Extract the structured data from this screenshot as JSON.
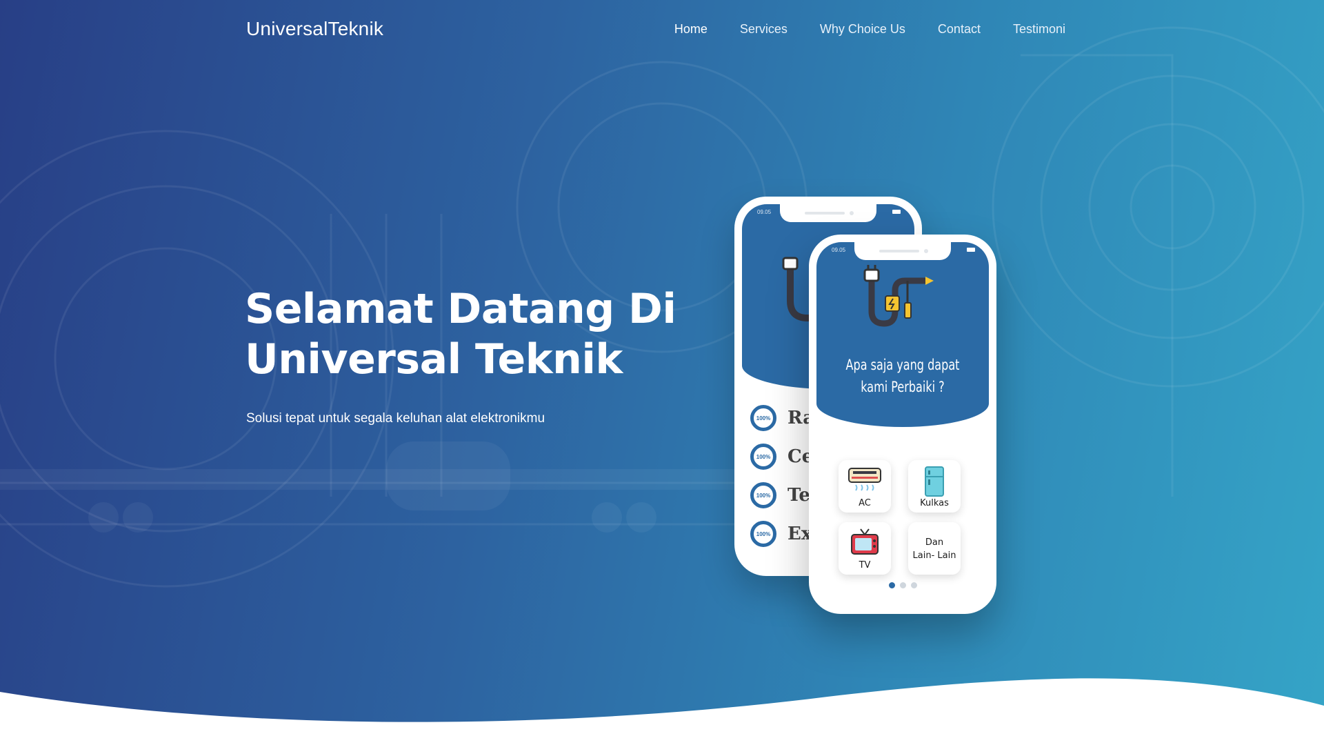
{
  "navbar": {
    "brand": "UniversalTeknik",
    "links": [
      "Home",
      "Services",
      "Why Choice Us",
      "Contact",
      "Testimoni"
    ],
    "active": "Home"
  },
  "hero": {
    "title_line1": "Selamat Datang Di",
    "title_line2": "Universal Teknik",
    "subtitle": "Solusi tepat untuk segala keluhan alat elektronikmu"
  },
  "phone_front": {
    "time": "09.05",
    "heading_line1": "Apa saja yang dapat",
    "heading_line2": "kami Perbaiki ?",
    "cards": [
      {
        "label": "AC",
        "icon": "air-conditioner-icon"
      },
      {
        "label": "Kulkas",
        "icon": "refrigerator-icon"
      },
      {
        "label": "TV",
        "icon": "television-icon"
      },
      {
        "label": "Dan Lain- Lain",
        "line1": "Dan",
        "line2": "Lain- Lain",
        "icon": ""
      }
    ],
    "carousel": {
      "count": 3,
      "active_index": 0
    }
  },
  "phone_back": {
    "time": "09.05",
    "badge": "100%",
    "items_partial": [
      "Ra",
      "Ce",
      "Te",
      "Ex"
    ]
  },
  "colors": {
    "gradient_start": "#283f86",
    "gradient_end": "#35a4c7",
    "screen_blue": "#2b6aa5",
    "white": "#ffffff"
  }
}
